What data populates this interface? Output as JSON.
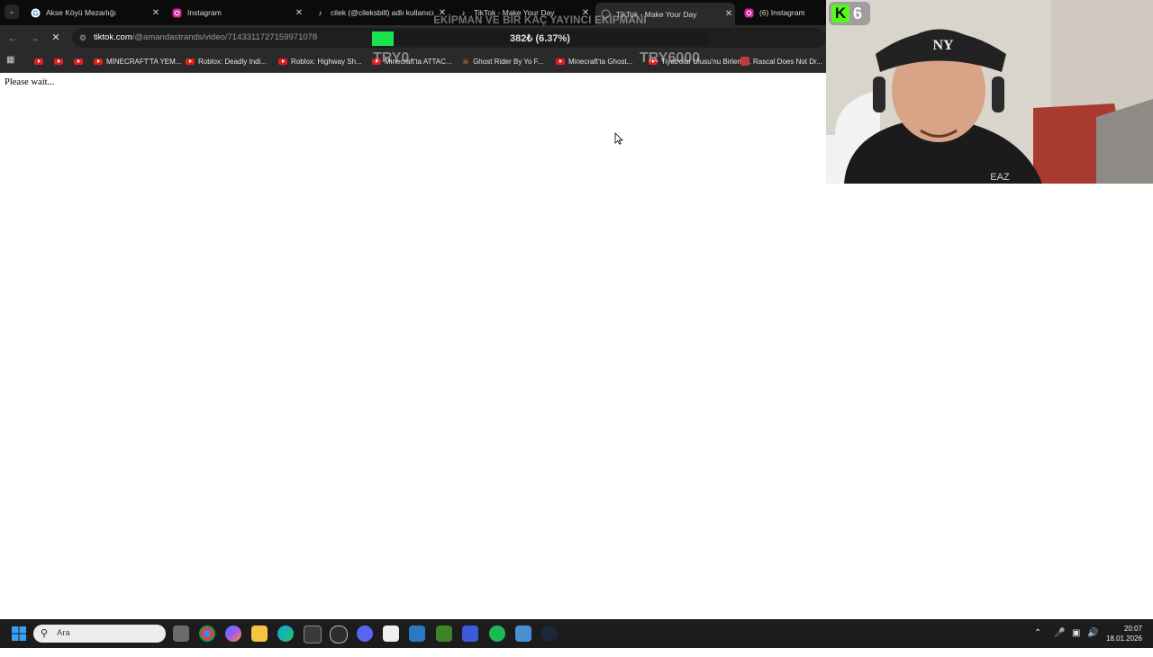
{
  "browser": {
    "tabs": [
      {
        "title": "Akse Köyü Mezarlığı",
        "active": false
      },
      {
        "title": "Instagram",
        "active": false
      },
      {
        "title": "cilek (@cileksbill) adlı kullanıcı",
        "active": false
      },
      {
        "title": "TikTok - Make Your Day",
        "active": false
      },
      {
        "title": "TikTok - Make Your Day",
        "active": true
      },
      {
        "title": "(6) Instagram",
        "active": false
      }
    ],
    "url_domain": "tiktok.com",
    "url_path": "/@amandastrands/video/7143311727159971078",
    "bookmarks": [
      "MİNECRAFT'TA YEM...",
      "Roblox: Deadly Indi...",
      "Roblox: Highway Sh...",
      "Minecraft'ta ATTAC...",
      "Ghost Rider By Yo F...",
      "Minecraft'ta Ghost...",
      "Tiyatrolar Ulusu'nu Birlend...",
      "Rascal Does Not Dr..."
    ]
  },
  "overlay": {
    "goal_title": "EKİPMAN VE BİR KAÇ YAYINCI EKİPMANI",
    "goal_text": "382₺ (6.37%)",
    "goal_fraction": 0.0637,
    "try_left": "TRY0",
    "try_right": "TRY6000",
    "kick_letter": "K",
    "kick_count": "6",
    "accent_color": "#19e34d"
  },
  "page": {
    "status_text": "Please wait..."
  },
  "taskbar": {
    "search_placeholder": "Ara",
    "time": "20:07",
    "date": "18.01.2026"
  }
}
